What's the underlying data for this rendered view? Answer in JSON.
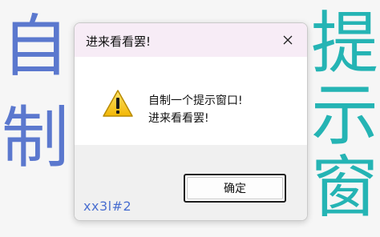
{
  "background": {
    "left_chars": [
      "自",
      "制"
    ],
    "right_chars": [
      "提",
      "示",
      "窗"
    ],
    "left_color": "#5b78ce",
    "right_color": "#25b4b4"
  },
  "dialog": {
    "title": "进来看看罢!",
    "message_lines": [
      "自制一个提示窗口!",
      "进来看看罢!"
    ],
    "ok_label": "确定",
    "icon": "warning-icon",
    "close_icon": "close-icon"
  },
  "watermark": "xx3l#2"
}
